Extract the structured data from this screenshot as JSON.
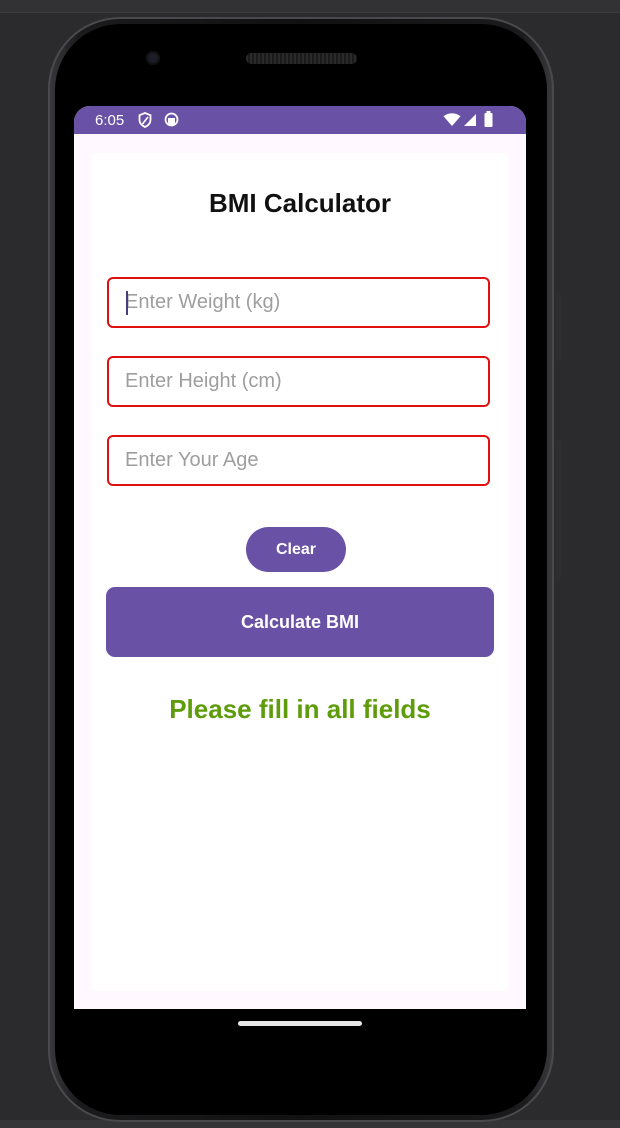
{
  "status_bar": {
    "time": "6:05",
    "icons": [
      "shield-icon",
      "app-icon",
      "wifi-icon",
      "signal-icon",
      "battery-icon"
    ],
    "color": "#6951a5"
  },
  "app": {
    "title": "BMI Calculator",
    "fields": [
      {
        "placeholder": "Enter Weight (kg)",
        "value": "",
        "focused": true
      },
      {
        "placeholder": "Enter Height (cm)",
        "value": ""
      },
      {
        "placeholder": "Enter Your Age",
        "value": ""
      }
    ],
    "clear_label": "Clear",
    "calculate_label": "Calculate BMI",
    "message": "Please fill in all fields",
    "colors": {
      "primary": "#6951a5",
      "error_border": "#e01010",
      "message": "#5f9c0b"
    }
  }
}
